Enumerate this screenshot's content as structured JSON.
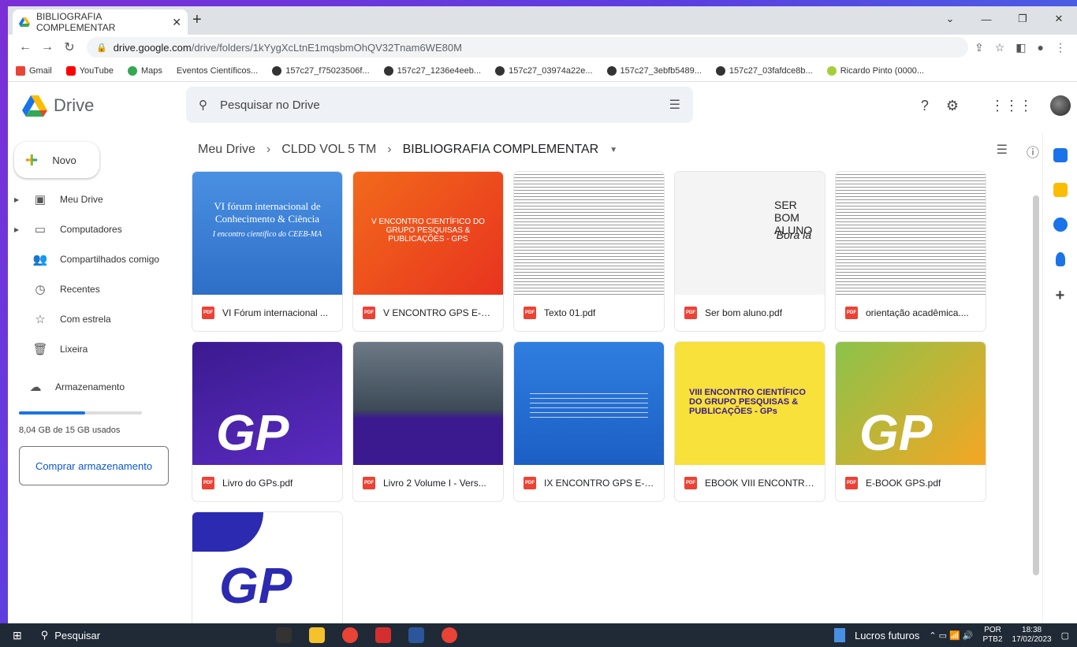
{
  "browser": {
    "tab_title": "BIBLIOGRAFIA COMPLEMENTAR",
    "url_host": "drive.google.com",
    "url_path": "/drive/folders/1kYygXcLtnE1mqsbmOhQV32Tnam6WE80M",
    "bookmarks": [
      "Gmail",
      "YouTube",
      "Maps",
      "Eventos Científicos...",
      "157c27_f75023506f...",
      "157c27_1236e4eeb...",
      "157c27_03974a22e...",
      "157c27_3ebfb5489...",
      "157c27_03fafdce8b...",
      "Ricardo Pinto (0000..."
    ]
  },
  "drive": {
    "logo_text": "Drive",
    "search_placeholder": "Pesquisar no Drive",
    "new_label": "Novo",
    "nav": [
      "Meu Drive",
      "Computadores",
      "Compartilhados comigo",
      "Recentes",
      "Com estrela",
      "Lixeira"
    ],
    "storage_label": "Armazenamento",
    "storage_used": "8,04 GB de 15 GB usados",
    "storage_fraction": 0.536,
    "buy_label": "Comprar armazenamento",
    "breadcrumb": [
      "Meu Drive",
      "CLDD VOL 5 TM",
      "BIBLIOGRAFIA COMPLEMENTAR"
    ],
    "files": [
      {
        "name": "VI Fórum internacional ...",
        "thumb_title": "VI fórum internacional de Conhecimento & Ciência",
        "thumb_sub": "I encontro científico do CEEB-MA"
      },
      {
        "name": "V ENCONTRO GPS E-B...",
        "thumb_title": "V ENCONTRO CIENTÍFICO DO GRUPO PESQUISAS & PUBLICAÇÕES - GPS"
      },
      {
        "name": "Texto 01.pdf"
      },
      {
        "name": "Ser bom aluno.pdf",
        "thumb_title": "SER BOM ALUNO",
        "thumb_sub": "'Bora lá"
      },
      {
        "name": "orientação acadêmica...."
      },
      {
        "name": "Livro do GPs.pdf"
      },
      {
        "name": "Livro 2 Volume I - Vers..."
      },
      {
        "name": "IX ENCONTRO GPS E-B..."
      },
      {
        "name": "EBOOK VIII ENCONTRO...",
        "thumb_title": "VIII ENCONTRO CIENTÍFICO DO GRUPO PESQUISAS & PUBLICAÇÕES - GPs"
      },
      {
        "name": "E-BOOK GPS.pdf"
      },
      {
        "name": ""
      }
    ]
  },
  "taskbar": {
    "search": "Pesquisar",
    "weather": "Lucros futuros",
    "lang": "POR",
    "lang2": "PTB2",
    "time": "18:38",
    "date": "17/02/2023"
  }
}
